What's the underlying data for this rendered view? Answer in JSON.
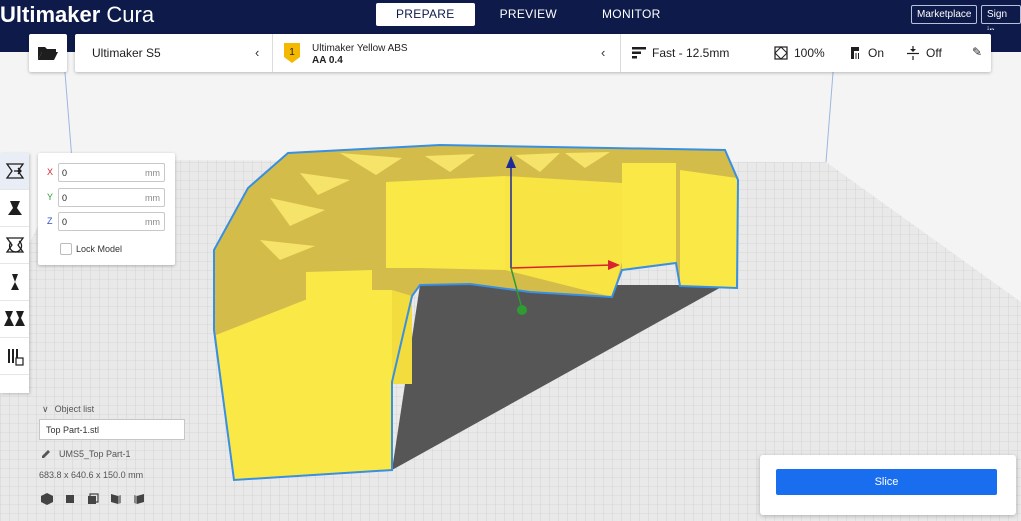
{
  "app": {
    "brand_bold": "Ultimaker",
    "brand_light": "Cura"
  },
  "header": {
    "tabs": [
      {
        "label": "PREPARE",
        "active": true
      },
      {
        "label": "PREVIEW",
        "active": false
      },
      {
        "label": "MONITOR",
        "active": false
      }
    ],
    "marketplace_label": "Marketplace",
    "signin_label": "Sign in"
  },
  "toolbar": {
    "open_icon": "folder-open-icon",
    "printer": {
      "name": "Ultimaker S5"
    },
    "material": {
      "name": "Ultimaker Yellow ABS",
      "nozzle": "AA 0.4",
      "badge_number": "1",
      "badge_color": "#f5b800"
    },
    "print_settings": {
      "profile": "Fast - 12.5mm",
      "infill": "100%",
      "support": "On",
      "adhesion": "Off"
    }
  },
  "move_tool": {
    "x": {
      "label": "X",
      "value": "0",
      "unit": "mm",
      "color": "#d9232e"
    },
    "y": {
      "label": "Y",
      "value": "0",
      "unit": "mm",
      "color": "#2e9b33"
    },
    "z": {
      "label": "Z",
      "value": "0",
      "unit": "mm",
      "color": "#3050c8"
    },
    "lock_label": "Lock Model",
    "lock_checked": false
  },
  "tools": [
    "move-tool-icon",
    "scale-tool-icon",
    "rotate-tool-icon",
    "mirror-tool-icon",
    "per-model-settings-icon",
    "support-blocker-icon"
  ],
  "object_list": {
    "toggle_label": "Object list",
    "selected_file": "Top Part-1.stl",
    "job_name": "UMS5_Top Part-1",
    "dimensions": "683.8 x 640.6 x 150.0 mm"
  },
  "slice": {
    "label": "Slice"
  },
  "colors": {
    "header_bg": "#0e1a4a",
    "accent": "#196ef0",
    "model": "#fae846",
    "model_outline": "#3a8fe0"
  }
}
